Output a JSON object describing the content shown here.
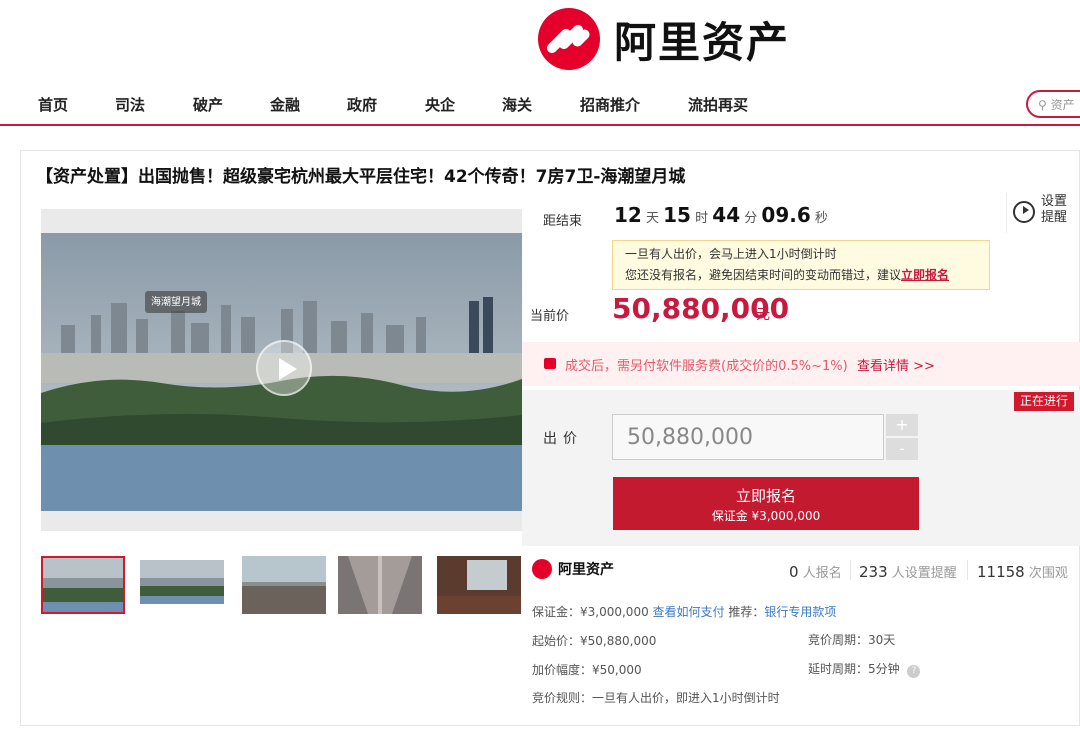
{
  "brand": {
    "name": "阿里资产"
  },
  "nav": {
    "items": [
      "首页",
      "司法",
      "破产",
      "金融",
      "政府",
      "央企",
      "海关",
      "招商推介",
      "流拍再买"
    ],
    "search_placeholder": "资产"
  },
  "item": {
    "title": "【资产处置】出国抛售！超级豪宅杭州最大平层住宅！42个传奇！7房7卫-海潮望月城",
    "image_caption": "海潮望月城"
  },
  "countdown": {
    "label": "距结束",
    "days": "12",
    "days_unit": "天",
    "hours": "15",
    "hours_unit": "时",
    "minutes": "44",
    "minutes_unit": "分",
    "seconds": "09.6",
    "seconds_unit": "秒"
  },
  "reminder": {
    "label": "设置提醒"
  },
  "notice": {
    "line1": "一旦有人出价，会马上进入1小时倒计时",
    "line2_prefix": "您还没有报名，避免因结束时间的变动而错过，建议",
    "line2_link": "立即报名"
  },
  "price": {
    "label": "当前价",
    "value": "50,880,000",
    "unit": "元"
  },
  "fee": {
    "text": "成交后，需另付软件服务费(成交价的0.5%~1%)",
    "link": "查看详情 >>"
  },
  "bid": {
    "status": "正在进行",
    "label": "出价",
    "value": "50,880,000",
    "plus": "+",
    "minus": "-",
    "signup_label": "立即报名",
    "deposit_text": "保证金 ¥3,000,000"
  },
  "stats": {
    "signups": "0",
    "signups_unit": "人报名",
    "reminders": "233",
    "reminders_unit": "人设置提醒",
    "views": "11158",
    "views_unit": "次围观"
  },
  "details": {
    "deposit": "保证金：¥3,000,000",
    "how_to_pay": "查看如何支付",
    "recommend": "推荐：",
    "bank_link": "银行专用款项",
    "start_price": "起始价：¥50,880,000",
    "bid_period": "竞价周期：30天",
    "increment": "加价幅度：¥50,000",
    "delay_period": "延时周期：5分钟",
    "rules": "竞价规则：一旦有人出价，即进入1小时倒计时"
  },
  "colors": {
    "brand_red": "#c8193e",
    "accent_red": "#d1192d",
    "link_blue": "#3a79c7"
  }
}
